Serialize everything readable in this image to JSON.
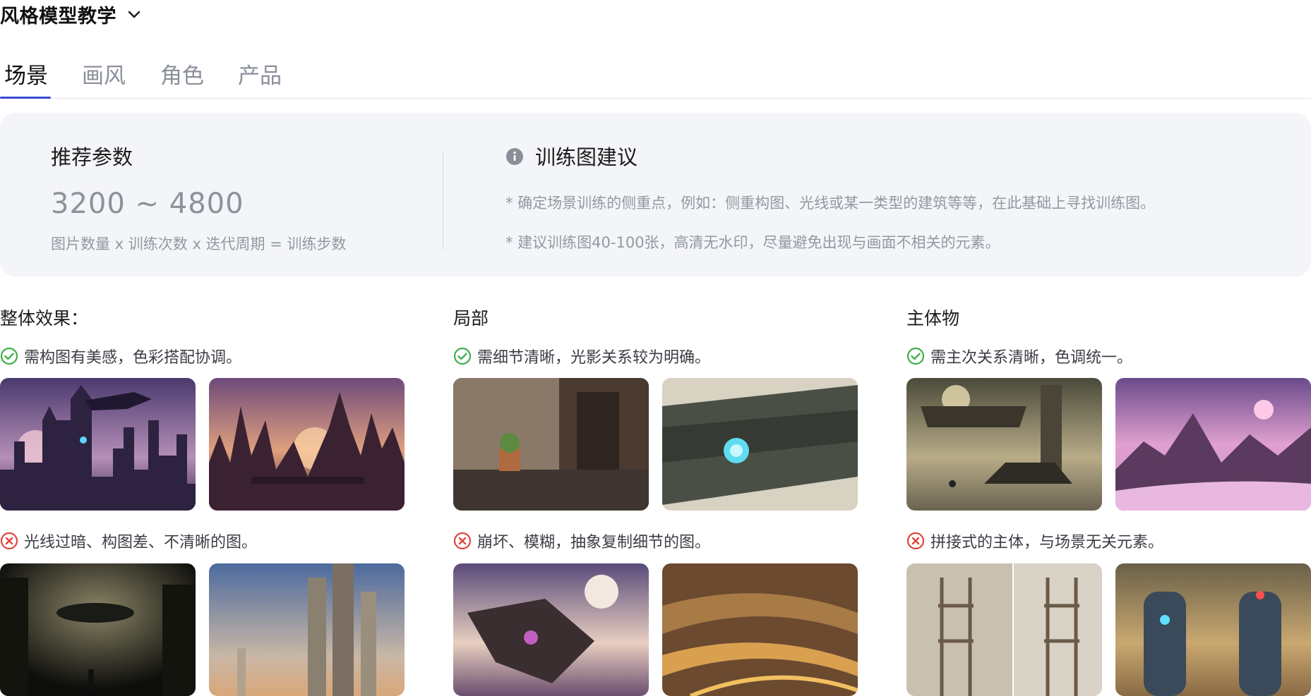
{
  "header": {
    "title": "风格模型教学"
  },
  "tabs": [
    {
      "label": "场景",
      "active": true
    },
    {
      "label": "画风",
      "active": false
    },
    {
      "label": "角色",
      "active": false
    },
    {
      "label": "产品",
      "active": false
    }
  ],
  "params": {
    "title": "推荐参数",
    "range": "3200 ~ 4800",
    "formula": "图片数量 x 训练次数 x 迭代周期 = 训练步数"
  },
  "suggestions": {
    "title": "训练图建议",
    "tips": [
      "* 确定场景训练的侧重点，例如：侧重构图、光线或某一类型的建筑等等，在此基础上寻找训练图。",
      "* 建议训练图40-100张，高清无水印，尽量避免出现与画面不相关的元素。"
    ]
  },
  "sections": [
    {
      "title": "整体效果：",
      "good": "需构图有美感，色彩搭配协调。",
      "bad": "光线过暗、构图差、不清晰的图。"
    },
    {
      "title": "局部",
      "good": "需细节清晰，光影关系较为明确。",
      "bad": "崩坏、模糊，抽象复制细节的图。"
    },
    {
      "title": "主体物",
      "good": "需主次关系清晰，色调统一。",
      "bad": "拼接式的主体，与场景无关元素。"
    }
  ],
  "colors": {
    "accent": "#3b48d6",
    "good": "#3fae4a",
    "bad": "#e0453b",
    "panel_bg": "#f4f5f8"
  },
  "icons": {
    "good": "check-circle-icon",
    "bad": "x-circle-icon",
    "info": "info-icon",
    "dropdown": "chevron-down-icon"
  }
}
